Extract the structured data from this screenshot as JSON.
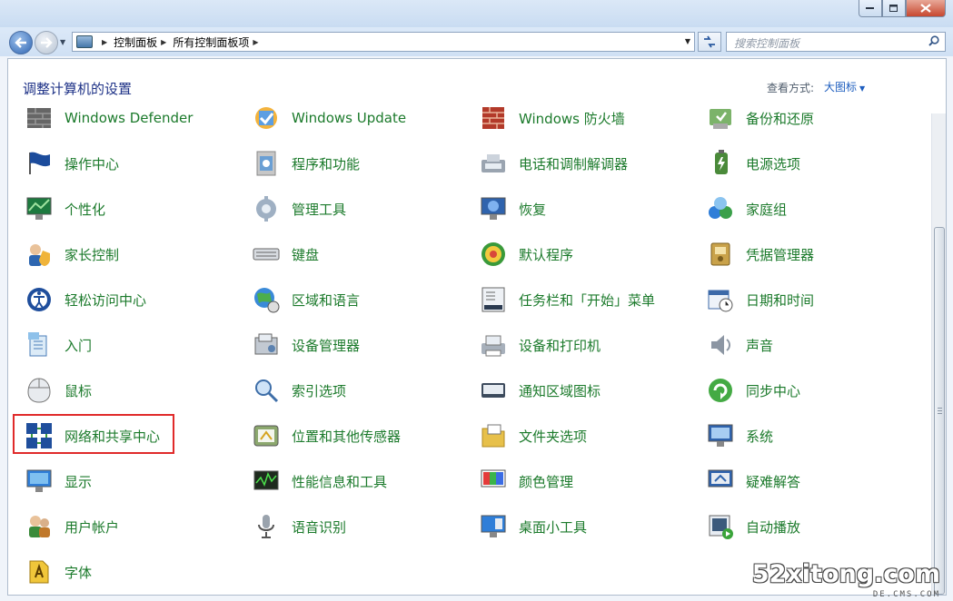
{
  "breadcrumb": [
    "控制面板",
    "所有控制面板项"
  ],
  "search": {
    "placeholder": "搜索控制面板"
  },
  "header": {
    "title": "调整计算机的设置",
    "view_by_label": "查看方式:",
    "view_by_value": "大图标"
  },
  "items": [
    [
      "Windows Defender",
      "Windows Update",
      "Windows 防火墙",
      "备份和还原"
    ],
    [
      "操作中心",
      "程序和功能",
      "电话和调制解调器",
      "电源选项"
    ],
    [
      "个性化",
      "管理工具",
      "恢复",
      "家庭组"
    ],
    [
      "家长控制",
      "键盘",
      "默认程序",
      "凭据管理器"
    ],
    [
      "轻松访问中心",
      "区域和语言",
      "任务栏和「开始」菜单",
      "日期和时间"
    ],
    [
      "入门",
      "设备管理器",
      "设备和打印机",
      "声音"
    ],
    [
      "鼠标",
      "索引选项",
      "通知区域图标",
      "同步中心"
    ],
    [
      "网络和共享中心",
      "位置和其他传感器",
      "文件夹选项",
      "系统"
    ],
    [
      "显示",
      "性能信息和工具",
      "颜色管理",
      "疑难解答"
    ],
    [
      "用户帐户",
      "语音识别",
      "桌面小工具",
      "自动播放"
    ],
    [
      "字体",
      null,
      null,
      null
    ]
  ],
  "highlighted_item": "网络和共享中心",
  "watermark": {
    "main": "52xitong.com",
    "sub": "DE.CMS.COM"
  },
  "colors": {
    "link_green": "#1b7a2b",
    "title_blue": "#1e3287",
    "highlight_red": "#e02a2a"
  }
}
